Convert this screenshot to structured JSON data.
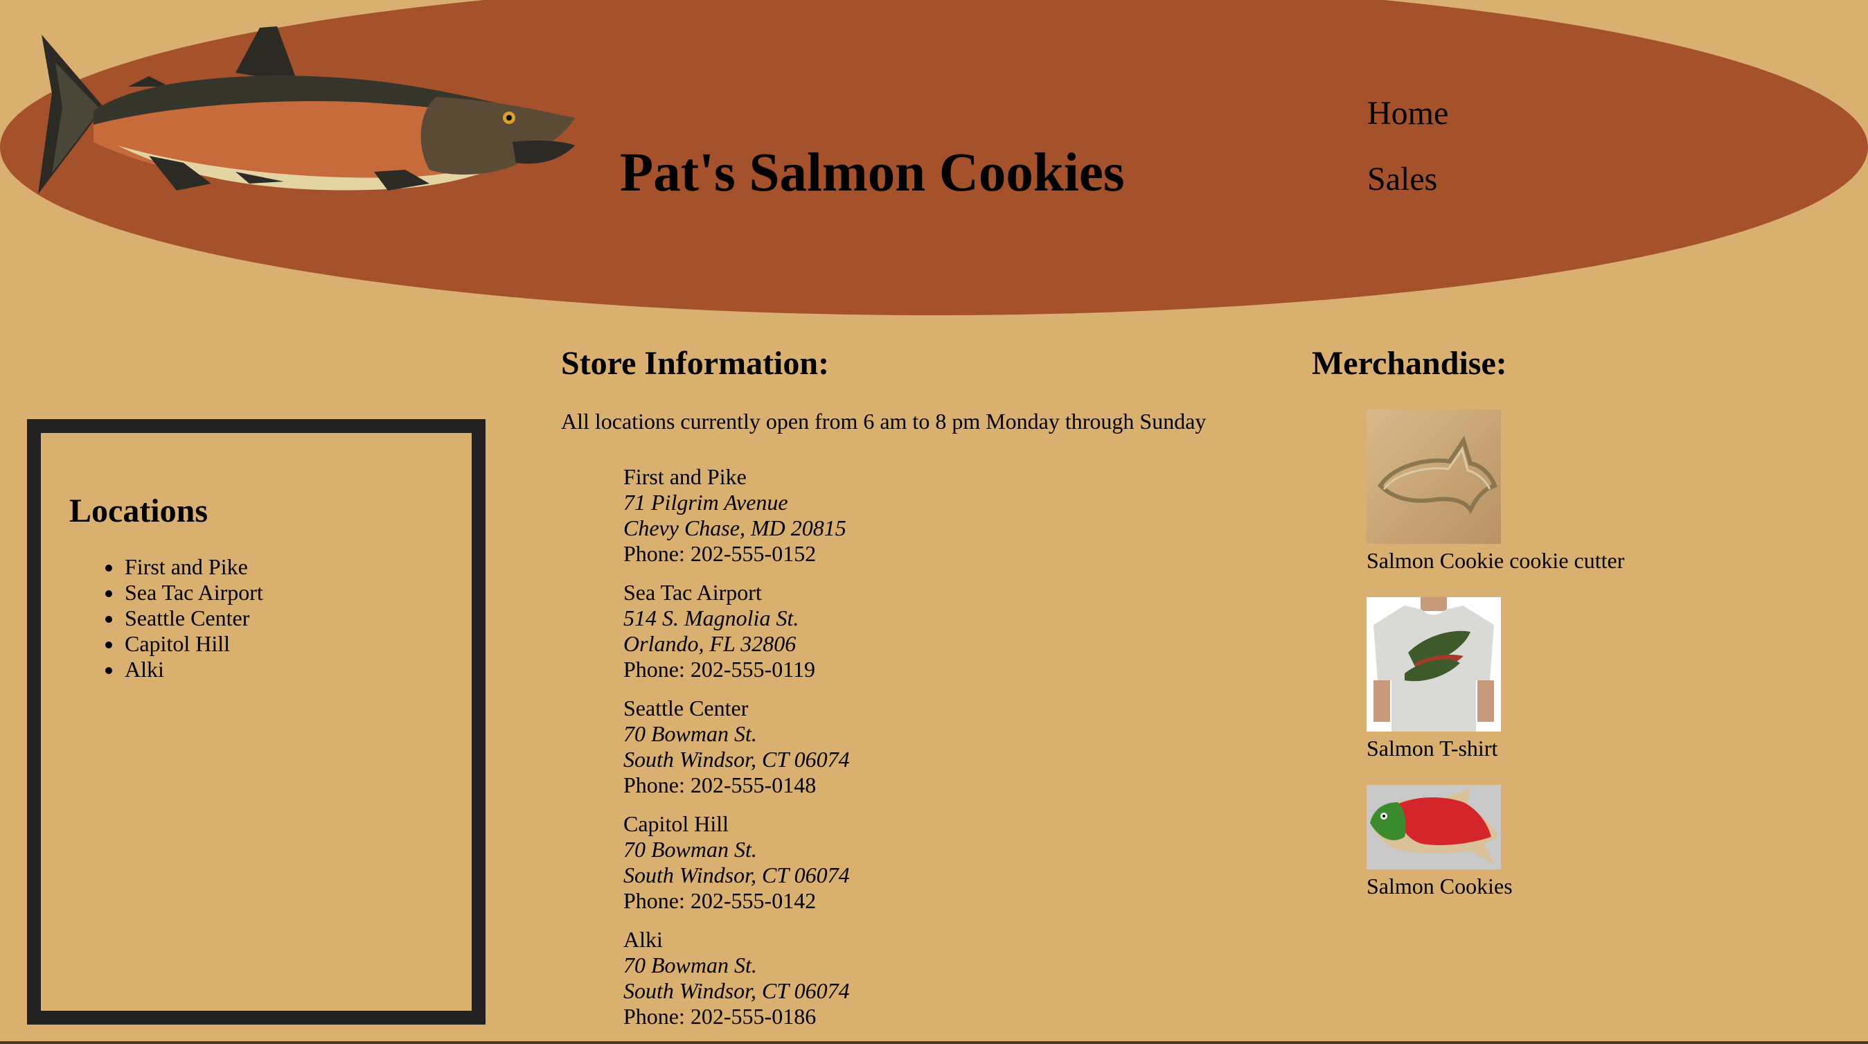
{
  "header": {
    "site_title": "Pat's Salmon Cookies",
    "logo_icon": "salmon-fish-icon"
  },
  "nav": {
    "items": [
      {
        "label": "Home"
      },
      {
        "label": "Sales"
      }
    ]
  },
  "sidebar": {
    "title": "Locations",
    "items": [
      {
        "label": "First and Pike"
      },
      {
        "label": "Sea Tac Airport"
      },
      {
        "label": "Seattle Center"
      },
      {
        "label": "Capitol Hill"
      },
      {
        "label": "Alki"
      }
    ]
  },
  "store_info": {
    "title": "Store Information:",
    "hours": "All locations currently open from 6 am to 8 pm Monday through Sunday",
    "stores": [
      {
        "name": "First and Pike",
        "street": "71 Pilgrim Avenue",
        "city": "Chevy Chase, MD 20815",
        "phone": "Phone: 202-555-0152"
      },
      {
        "name": "Sea Tac Airport",
        "street": "514 S. Magnolia St.",
        "city": "Orlando, FL 32806",
        "phone": "Phone: 202-555-0119"
      },
      {
        "name": "Seattle Center",
        "street": "70 Bowman St.",
        "city": "South Windsor, CT 06074",
        "phone": "Phone: 202-555-0148"
      },
      {
        "name": "Capitol Hill",
        "street": "70 Bowman St.",
        "city": "South Windsor, CT 06074",
        "phone": "Phone: 202-555-0142"
      },
      {
        "name": "Alki",
        "street": "70 Bowman St.",
        "city": "South Windsor, CT 06074",
        "phone": "Phone: 202-555-0186"
      }
    ]
  },
  "merchandise": {
    "title": "Merchandise:",
    "items": [
      {
        "caption": "Salmon Cookie cookie cutter",
        "icon": "cookie-cutter-image"
      },
      {
        "caption": "Salmon T-shirt",
        "icon": "tshirt-image"
      },
      {
        "caption": "Salmon Cookies",
        "icon": "salmon-cookie-image"
      }
    ]
  },
  "colors": {
    "background": "#d9b06f",
    "header_ellipse": "#a5512c",
    "box_border": "#222222"
  }
}
